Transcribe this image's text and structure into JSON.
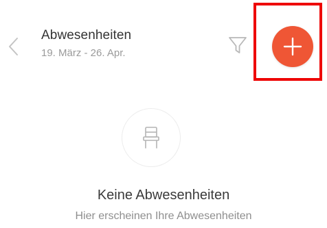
{
  "header": {
    "title": "Abwesenheiten",
    "date_range": "19. März - 26. Apr."
  },
  "icons": {
    "back": "chevron-left-icon",
    "filter": "filter-icon",
    "add": "plus-icon",
    "empty_state": "chair-icon"
  },
  "colors": {
    "accent": "#ef5635",
    "highlight": "#ee0000"
  },
  "empty_state": {
    "title": "Keine Abwesenheiten",
    "subtitle": "Hier erscheinen Ihre Abwesenheiten"
  }
}
